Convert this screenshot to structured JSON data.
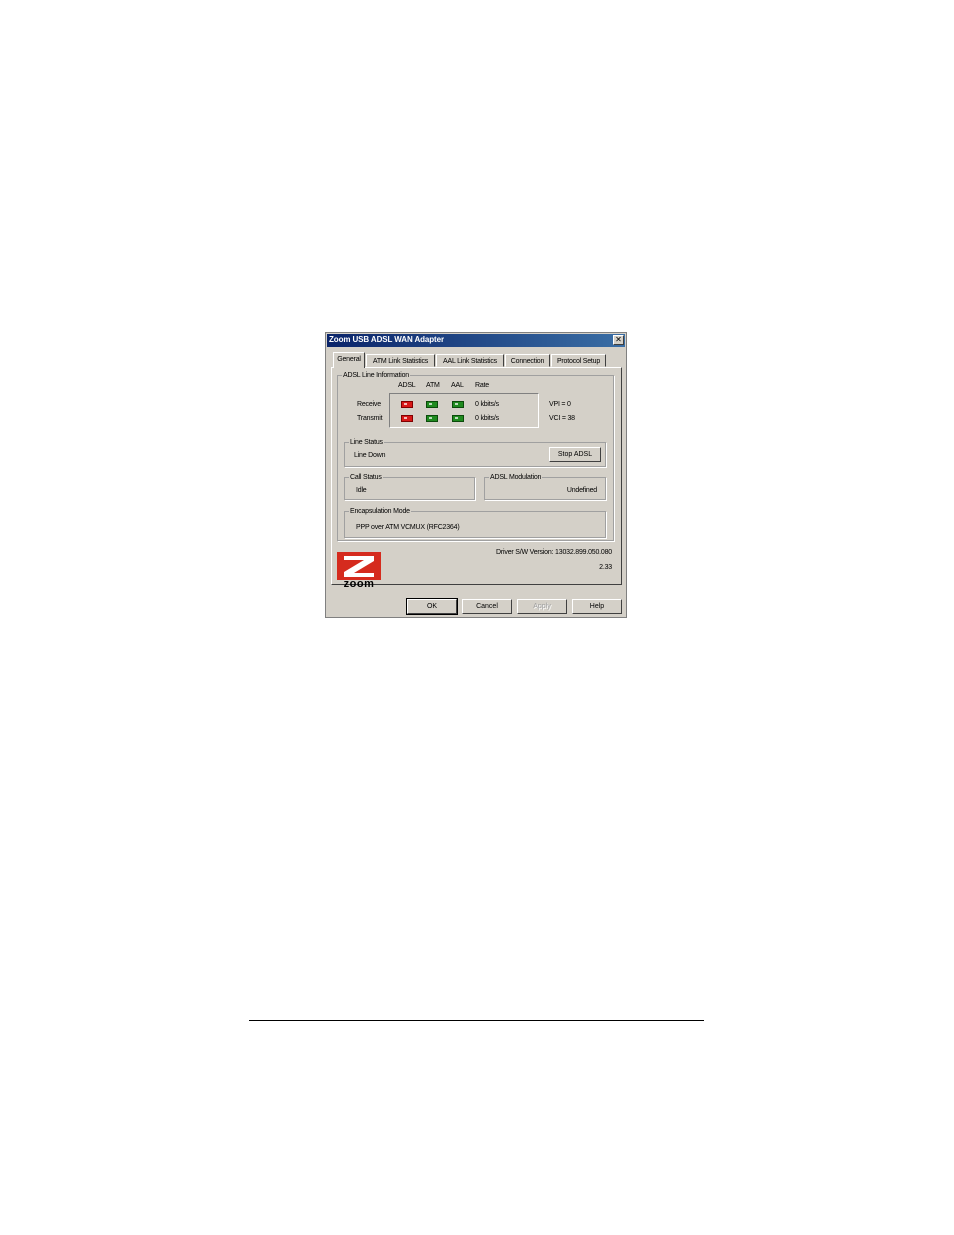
{
  "window": {
    "title": "Zoom USB ADSL WAN Adapter",
    "close_glyph": "✕"
  },
  "tabs": [
    {
      "label": "General"
    },
    {
      "label": "ATM Link Statistics"
    },
    {
      "label": "AAL Link Statistics"
    },
    {
      "label": "Connection"
    },
    {
      "label": "Protocol Setup"
    }
  ],
  "adsl_line_info": {
    "group_label": "ADSL Line Information",
    "headers": {
      "adsl": "ADSL",
      "atm": "ATM",
      "aal": "AAL",
      "rate": "Rate"
    },
    "receive": {
      "label": "Receive",
      "rate": "0 kbits/s",
      "adsl": "red",
      "atm": "green",
      "aal": "green"
    },
    "transmit": {
      "label": "Transmit",
      "rate": "0 kbits/s",
      "adsl": "red",
      "atm": "green",
      "aal": "green"
    },
    "vpi": "VPI = 0",
    "vci": "VCI = 38"
  },
  "line_status": {
    "group_label": "Line Status",
    "value": "Line Down",
    "button": "Stop ADSL"
  },
  "call_status": {
    "group_label": "Call Status",
    "value": "Idle"
  },
  "adsl_modulation": {
    "group_label": "ADSL Modulation",
    "value": "Undefined"
  },
  "encapsulation": {
    "group_label": "Encapsulation Mode",
    "value": "PPP over ATM VCMUX (RFC2364)"
  },
  "driver": {
    "version": "Driver S/W Version: 13032.899.050.080",
    "sub_version": "2.33"
  },
  "logo": {
    "text": "zoom",
    "icon": "zoom-z-logo"
  },
  "buttons": {
    "ok": "OK",
    "cancel": "Cancel",
    "apply": "Apply",
    "help": "Help"
  },
  "colors": {
    "titlebar": "#0a246a",
    "led_red": "#d81818",
    "led_green": "#1f8a1f",
    "logo_red": "#d52b1e"
  }
}
